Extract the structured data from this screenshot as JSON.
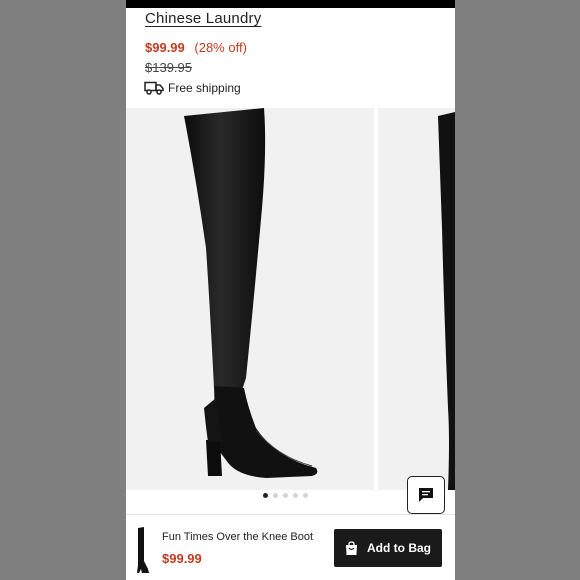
{
  "product": {
    "brand": "Chinese Laundry",
    "price": "$99.99",
    "discount": "(28% off)",
    "original_price": "$139.95",
    "shipping": "Free shipping"
  },
  "gallery": {
    "image_count": 5,
    "active_index": 0
  },
  "icons": {
    "shipping": "truck-icon",
    "chat": "chat-icon",
    "bag": "shopping-bag-icon"
  },
  "bottom_bar": {
    "title": "Fun Times Over the Knee Boot",
    "price": "$99.99",
    "add_button": "Add to Bag"
  },
  "colors": {
    "price_red": "#c23b1f",
    "button_dark": "#1a1a1a"
  }
}
